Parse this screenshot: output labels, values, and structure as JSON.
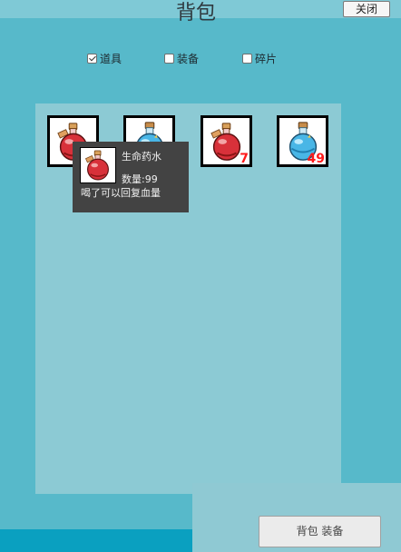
{
  "window": {
    "title": "背包",
    "close_label": "关闭"
  },
  "filters": [
    {
      "label": "道具",
      "checked": true
    },
    {
      "label": "装备",
      "checked": false
    },
    {
      "label": "碎片",
      "checked": false
    }
  ],
  "items": [
    {
      "icon": "red-potion-icon",
      "count": ""
    },
    {
      "icon": "blue-potion-icon",
      "count": ""
    },
    {
      "icon": "red-potion-icon",
      "count": "7"
    },
    {
      "icon": "blue-potion-icon",
      "count": "49"
    }
  ],
  "tooltip": {
    "icon": "red-potion-icon",
    "name": "生命药水",
    "quantity": "数量:99",
    "description": "喝了可以回复血量"
  },
  "bottom_button": {
    "label": "背包 装备"
  },
  "colors": {
    "red_potion": "#d8313a",
    "blue_potion": "#49b6e6",
    "count_text": "#ff1a1a"
  }
}
